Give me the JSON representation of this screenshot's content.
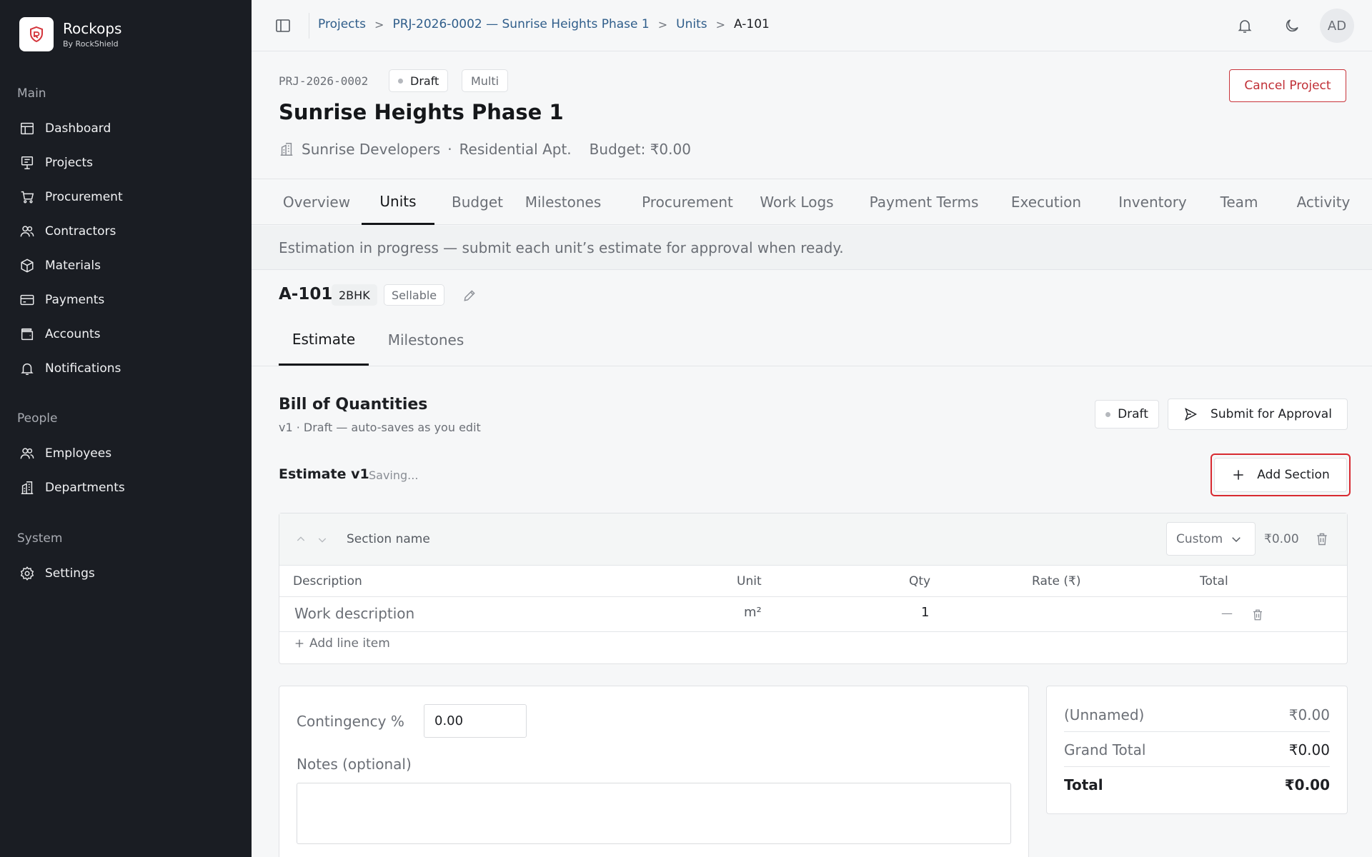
{
  "brand": {
    "name": "Rockops",
    "subtitle": "By RockShield"
  },
  "sidebar": {
    "groups": [
      {
        "label": "Main",
        "items": [
          {
            "label": "Dashboard",
            "icon": "dashboard-icon"
          },
          {
            "label": "Projects",
            "icon": "projects-icon"
          },
          {
            "label": "Procurement",
            "icon": "cart-icon"
          },
          {
            "label": "Contractors",
            "icon": "users-icon"
          },
          {
            "label": "Materials",
            "icon": "box-icon"
          },
          {
            "label": "Payments",
            "icon": "card-icon"
          },
          {
            "label": "Accounts",
            "icon": "wallet-icon"
          },
          {
            "label": "Notifications",
            "icon": "bell-icon"
          }
        ]
      },
      {
        "label": "People",
        "items": [
          {
            "label": "Employees",
            "icon": "users-icon"
          },
          {
            "label": "Departments",
            "icon": "building-icon"
          }
        ]
      },
      {
        "label": "System",
        "items": [
          {
            "label": "Settings",
            "icon": "gear-icon"
          }
        ]
      }
    ]
  },
  "breadcrumb": [
    "Projects",
    "PRJ-2026-0002 — Sunrise Heights Phase 1",
    "Units",
    "A-101"
  ],
  "user": {
    "initials": "AD"
  },
  "project": {
    "code": "PRJ-2026-0002",
    "status": "Draft",
    "mode": "Multi",
    "title": "Sunrise Heights Phase 1",
    "developer": "Sunrise Developers",
    "separator": "·",
    "type": "Residential Apt.",
    "budget": "Budget: ₹0.00",
    "cancel_label": "Cancel Project"
  },
  "tabs": [
    "Overview",
    "Units",
    "Budget",
    "Milestones",
    "Procurement",
    "Work Logs",
    "Payment Terms",
    "Execution",
    "Inventory",
    "Team",
    "Activity"
  ],
  "active_tab": "Units",
  "banner": "Estimation in progress — submit each unit’s estimate for approval when ready.",
  "unit": {
    "name": "A-101",
    "type": "2BHK",
    "tag": "Sellable"
  },
  "subtabs": [
    "Estimate",
    "Milestones"
  ],
  "boq": {
    "title": "Bill of Quantities",
    "subtitle": "v1 · Draft — auto-saves as you edit",
    "status": "Draft",
    "submit_label": "Submit for Approval",
    "estimate_title": "Estimate v1",
    "saving": "Saving...",
    "add_section_label": "Add Section"
  },
  "section": {
    "name_placeholder": "Section name",
    "mode": "Custom",
    "amount": "₹0.00",
    "columns": [
      "Description",
      "Unit",
      "Qty",
      "Rate (₹)",
      "Total"
    ],
    "row": {
      "description_placeholder": "Work description",
      "unit": "m²",
      "qty": "1",
      "total": "—"
    },
    "add_line_label": "Add line item"
  },
  "contingency": {
    "label": "Contingency %",
    "value": "0.00"
  },
  "notes": {
    "label": "Notes (optional)"
  },
  "summary": {
    "rows": [
      {
        "label": "(Unnamed)",
        "value": "₹0.00"
      },
      {
        "label": "Grand Total",
        "value": "₹0.00"
      },
      {
        "label": "Total",
        "value": "₹0.00"
      }
    ]
  }
}
